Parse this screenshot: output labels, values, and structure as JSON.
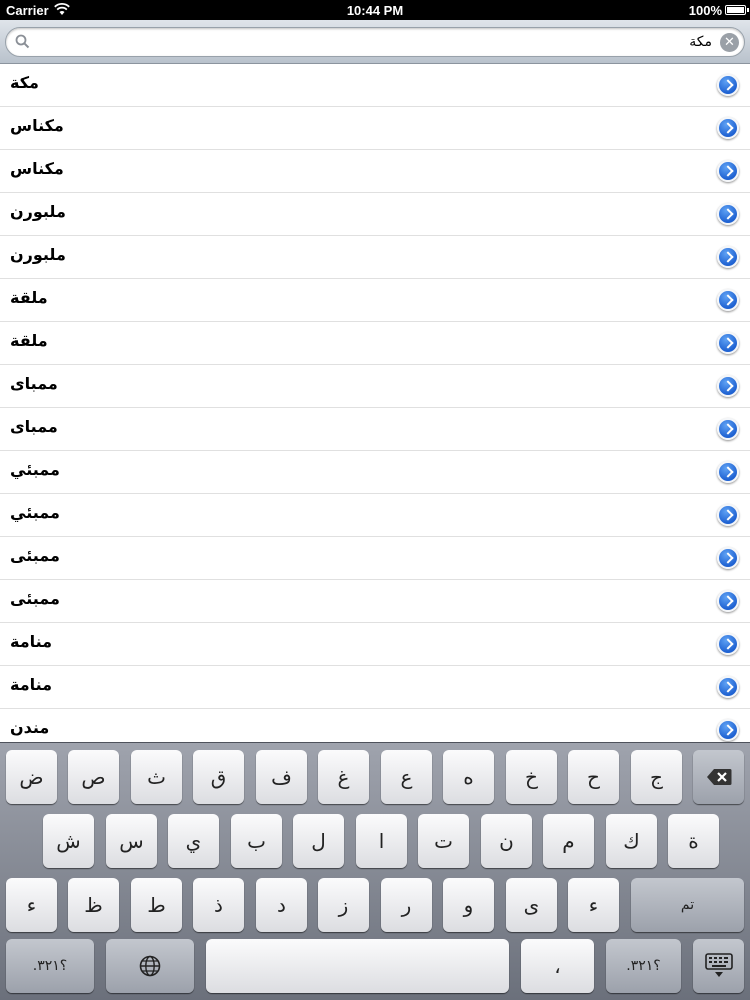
{
  "status_bar": {
    "carrier": "Carrier",
    "time": "10:44 PM",
    "battery": "100%"
  },
  "search": {
    "value": "مكة",
    "clear": "✕"
  },
  "list": {
    "items": [
      "مكة",
      "مكناس",
      "مكناس",
      "ملبورن",
      "ملبورن",
      "ملقة",
      "ملقة",
      "ممباى",
      "ممباى",
      "ممبئي",
      "ممبئي",
      "ممبئى",
      "ممبئى",
      "منامة",
      "منامة",
      "مندن"
    ]
  },
  "keyboard": {
    "row1": [
      "ض",
      "ص",
      "ث",
      "ق",
      "ف",
      "غ",
      "ع",
      "ه",
      "خ",
      "ح",
      "ج"
    ],
    "row2": [
      "ش",
      "س",
      "ي",
      "ب",
      "ل",
      "ا",
      "ت",
      "ن",
      "م",
      "ك",
      "ة"
    ],
    "row3": [
      "ء",
      "ظ",
      "ط",
      "ذ",
      "د",
      "ز",
      "ر",
      "و",
      "ى",
      "ء"
    ],
    "numbers_left": ".؟٣٢١",
    "numbers_right": ".؟٣٢١",
    "return_label": "تم",
    "comma": "،"
  },
  "colors": {
    "accent": "#2a6edc",
    "keyboard_bg": "#8a8f99",
    "search_bg": "#c9d0d8"
  }
}
